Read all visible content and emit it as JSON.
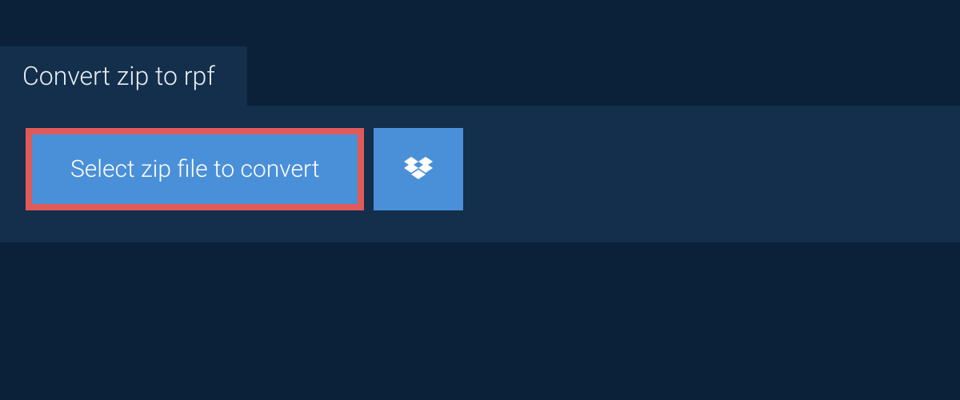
{
  "tab": {
    "title": "Convert zip to rpf"
  },
  "actions": {
    "select_file_label": "Select zip file to convert"
  }
}
